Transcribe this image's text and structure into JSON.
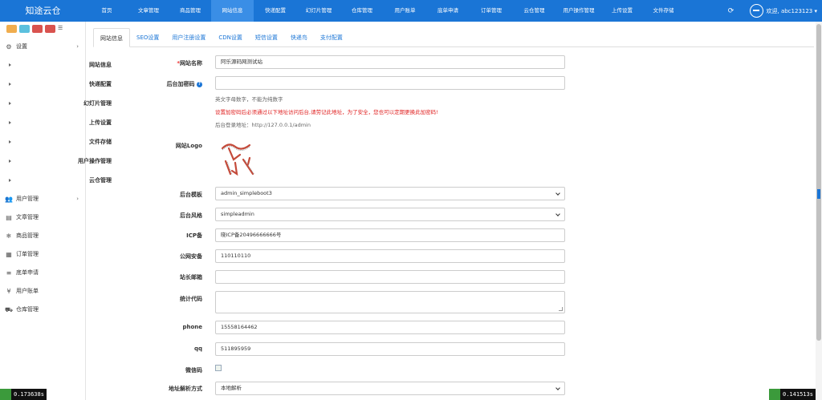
{
  "brand": "知途云仓",
  "nav": [
    {
      "label": "首页",
      "active": false
    },
    {
      "label": "文章管理",
      "active": false
    },
    {
      "label": "商品管理",
      "active": false
    },
    {
      "label": "网站信息",
      "active": true
    },
    {
      "label": "快递配置",
      "active": false
    },
    {
      "label": "幻灯片管理",
      "active": false
    },
    {
      "label": "仓库管理",
      "active": false
    },
    {
      "label": "用户账单",
      "active": false
    },
    {
      "label": "底单申请",
      "active": false
    },
    {
      "label": "订单管理",
      "active": false
    },
    {
      "label": "云仓管理",
      "active": false
    },
    {
      "label": "用户操作管理",
      "active": false
    },
    {
      "label": "上传设置",
      "active": false
    },
    {
      "label": "文件存储",
      "active": false
    }
  ],
  "user": {
    "greeting": "欢迎, abc123123 ▾"
  },
  "quick_colors": [
    "#f0ad4e",
    "#5bc0de",
    "#d9534f",
    "#d9534f"
  ],
  "sidebar": {
    "settings": {
      "label": "设置"
    },
    "sub_items": [
      "网站信息",
      "快递配置",
      "幻灯片管理",
      "上传设置",
      "文件存储",
      "用户操作管理",
      "云仓管理"
    ],
    "groups": [
      {
        "label": "用户管理",
        "icon": "users-icon",
        "has_children": true
      },
      {
        "label": "文章管理",
        "icon": "article-icon",
        "has_children": false
      },
      {
        "label": "商品管理",
        "icon": "snowflake-icon",
        "has_children": false
      },
      {
        "label": "订单管理",
        "icon": "order-icon",
        "has_children": false
      },
      {
        "label": "底单申请",
        "icon": "list-icon",
        "has_children": false
      },
      {
        "label": "用户账单",
        "icon": "yen-icon",
        "has_children": false
      },
      {
        "label": "仓库管理",
        "icon": "truck-icon",
        "has_children": false
      }
    ]
  },
  "tabs": [
    "网站信息",
    "SEO设置",
    "用户注册设置",
    "CDN设置",
    "短信设置",
    "快递鸟",
    "支付配置"
  ],
  "form": {
    "site_name": {
      "label": "网站名称",
      "value": "阿乐源码网测试站"
    },
    "admin_code": {
      "label": "后台加密码",
      "value": ""
    },
    "admin_code_help1": "英文字母数字，不能为纯数字",
    "admin_code_warn": "设置加密码后必须通过以下地址访问后台,请劳记此地址，为了安全，您也可以定期更换此加密码!",
    "admin_code_help2": "后台登录地址：http://127.0.0.1/admin",
    "logo_label": "网站Logo",
    "admin_theme": {
      "label": "后台模板",
      "value": "admin_simpleboot3"
    },
    "admin_style": {
      "label": "后台风格",
      "value": "simpleadmin"
    },
    "icp": {
      "label": "ICP备",
      "value": "晓ICP备20496666666号"
    },
    "police": {
      "label": "公网安备",
      "value": "110110110"
    },
    "webmaster_email": {
      "label": "站长邮箱",
      "value": ""
    },
    "stat_code": {
      "label": "统计代码",
      "value": ""
    },
    "phone": {
      "label": "phone",
      "value": "15558164462"
    },
    "qq": {
      "label": "qq",
      "value": "511895959"
    },
    "wechat": {
      "label": "微信码"
    },
    "address_parse": {
      "label": "地址解析方式",
      "value": "本地解析"
    }
  },
  "perf": {
    "left": "0.173638s",
    "right": "0.141513s"
  }
}
